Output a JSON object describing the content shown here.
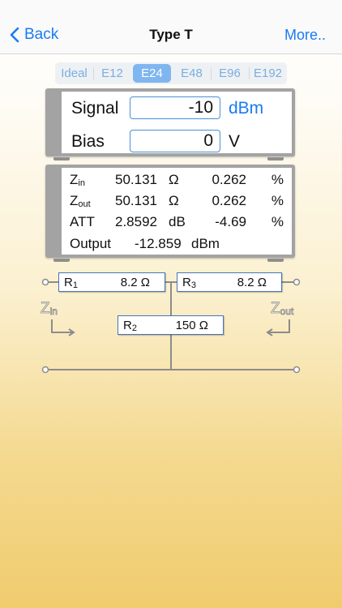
{
  "nav": {
    "back_label": "Back",
    "title": "Type T",
    "more_label": "More.."
  },
  "series": [
    "Ideal",
    "E12",
    "E24",
    "E48",
    "E96",
    "E192"
  ],
  "selected_series": "E24",
  "inputs": {
    "signal": {
      "label": "Signal",
      "value": "-10",
      "unit": "dBm"
    },
    "bias": {
      "label": "Bias",
      "value": "0",
      "unit": "V"
    }
  },
  "results": {
    "zin": {
      "label_main": "Z",
      "label_sub": "in",
      "value": "50.131",
      "unit": "Ω",
      "err": "0.262",
      "err_unit": "%"
    },
    "zout": {
      "label_main": "Z",
      "label_sub": "out",
      "value": "50.131",
      "unit": "Ω",
      "err": "0.262",
      "err_unit": "%"
    },
    "att": {
      "label": "ATT",
      "value": "2.8592",
      "unit": "dB",
      "err": "-4.69",
      "err_unit": "%"
    },
    "output": {
      "label": "Output",
      "value": "-12.859",
      "unit": "dBm"
    }
  },
  "circuit": {
    "r1": {
      "name_main": "R",
      "name_sub": "1",
      "value": "8.2 Ω"
    },
    "r3": {
      "name_main": "R",
      "name_sub": "3",
      "value": "8.2 Ω"
    },
    "r2": {
      "name_main": "R",
      "name_sub": "2",
      "value": "150 Ω"
    },
    "zin": {
      "main": "Z",
      "sub": "in"
    },
    "zout": {
      "main": "Z",
      "sub": "out"
    }
  },
  "colors": {
    "accent": "#1a7bf2",
    "segment_selected": "#7fb6ef",
    "panel_frame": "#a3a3a3"
  }
}
